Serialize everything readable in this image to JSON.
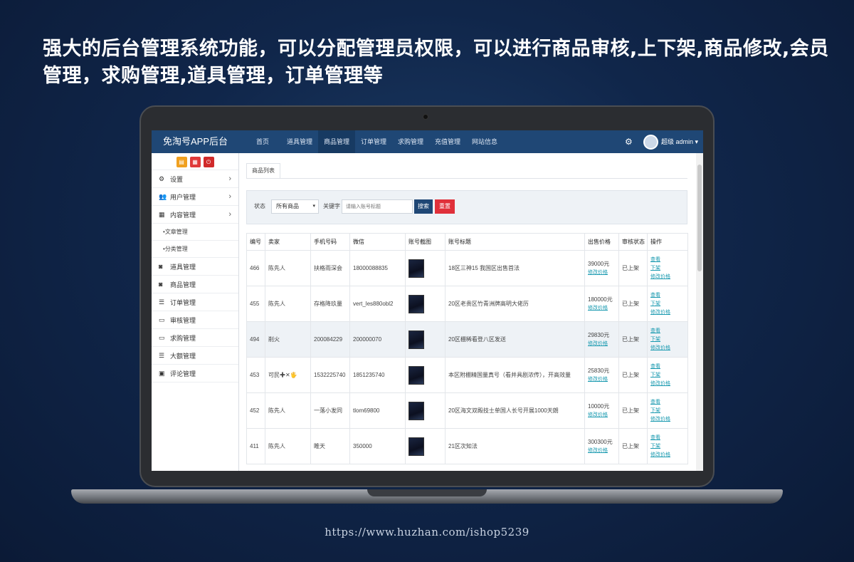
{
  "headline": "强大的后台管理系统功能，可以分配管理员权限，可以进行商品审核,上下架,商品修改,会员管理，求购管理,道具管理，订单管理等",
  "footer_url": "https://www.huzhan.com/ishop5239",
  "app": {
    "brand": "免淘号APP后台",
    "nav": [
      "首页",
      "道具管理",
      "商品管理",
      "订单管理",
      "求购管理",
      "充值管理",
      "网站信息"
    ],
    "active_nav": "商品管理",
    "user": "超级 admin"
  },
  "sidebar": {
    "buttons": [
      {
        "icon": "file-icon",
        "color": "#f0a020"
      },
      {
        "icon": "grid-icon",
        "color": "#e03a3a"
      },
      {
        "icon": "power-icon",
        "color": "#d02a2a"
      }
    ],
    "items": [
      {
        "label": "设置",
        "icon": "settings-icon",
        "arrow": true
      },
      {
        "label": "用户管理",
        "icon": "users-icon",
        "arrow": true
      },
      {
        "label": "内容管理",
        "icon": "grid-icon",
        "arrow": true
      }
    ],
    "sub_items": [
      "文章管理",
      "分类管理"
    ],
    "items2": [
      {
        "label": "道具管理",
        "icon": "mask-icon"
      },
      {
        "label": "商品管理",
        "icon": "mask-icon"
      },
      {
        "label": "订单管理",
        "icon": "list-icon"
      },
      {
        "label": "审核管理",
        "icon": "monitor-icon"
      },
      {
        "label": "求购管理",
        "icon": "monitor-icon"
      },
      {
        "label": "大额管理",
        "icon": "list-icon"
      },
      {
        "label": "评论管理",
        "icon": "comment-icon"
      }
    ]
  },
  "tab": "商品列表",
  "filter": {
    "status_label": "状态",
    "status_value": "所有商品",
    "keyword_label": "关键字",
    "keyword_placeholder": "请输入账号标题",
    "search_button": "搜索",
    "reset_button": "重置"
  },
  "table": {
    "headers": [
      "编号",
      "卖家",
      "手机号码",
      "微信",
      "账号截图",
      "账号标题",
      "出售价格",
      "审核状态",
      "操作"
    ],
    "rows": [
      {
        "id": "466",
        "seller": "陈先人",
        "phone": "扶格雨深会",
        "wechat": "18000088835",
        "title": "18区三神15 我国区出售首法",
        "price": "39000元",
        "price_link": "修改价格",
        "status": "已上架",
        "ops": [
          "查看",
          "下架",
          "修改价格"
        ]
      },
      {
        "id": "455",
        "seller": "陈先人",
        "phone": "存格降玖量",
        "wechat": "vert_les880obl2",
        "title": "20区老贵区竹青洲牌高明大佬历",
        "price": "180000元",
        "price_link": "修改价格",
        "status": "已上架",
        "ops": [
          "查看",
          "下架",
          "修改价格"
        ]
      },
      {
        "id": "494",
        "seller": "削火",
        "phone": "200084229",
        "wechat": "200000070",
        "title": "20区棚稀看登八区发送",
        "price": "29830元",
        "price_link": "修改价格",
        "status": "已上架",
        "ops": [
          "查看",
          "下架",
          "修改价格"
        ]
      },
      {
        "id": "453",
        "seller": "可民✚✕🖐",
        "phone": "1532225740",
        "wechat": "1851235740",
        "title": "本区附棚精国量真号（看并具剧浓传），开高效量",
        "price": "25830元",
        "price_link": "修改价格",
        "status": "已上架",
        "ops": [
          "查看",
          "下架",
          "修改价格"
        ]
      },
      {
        "id": "452",
        "seller": "陈先人",
        "phone": "一落小发同",
        "wechat": "tlom69800",
        "title": "20区海文双殿技士单国人长号开展1000天朗",
        "price": "10000元",
        "price_link": "修改价格",
        "status": "已上架",
        "ops": [
          "查看",
          "下架",
          "修改价格"
        ]
      },
      {
        "id": "411",
        "seller": "陈先人",
        "phone": "睢天",
        "wechat": "350000",
        "title": "21区次知法",
        "price": "300300元",
        "price_link": "修改价格",
        "status": "已上架",
        "ops": [
          "查看",
          "下架",
          "修改价格"
        ]
      }
    ]
  }
}
